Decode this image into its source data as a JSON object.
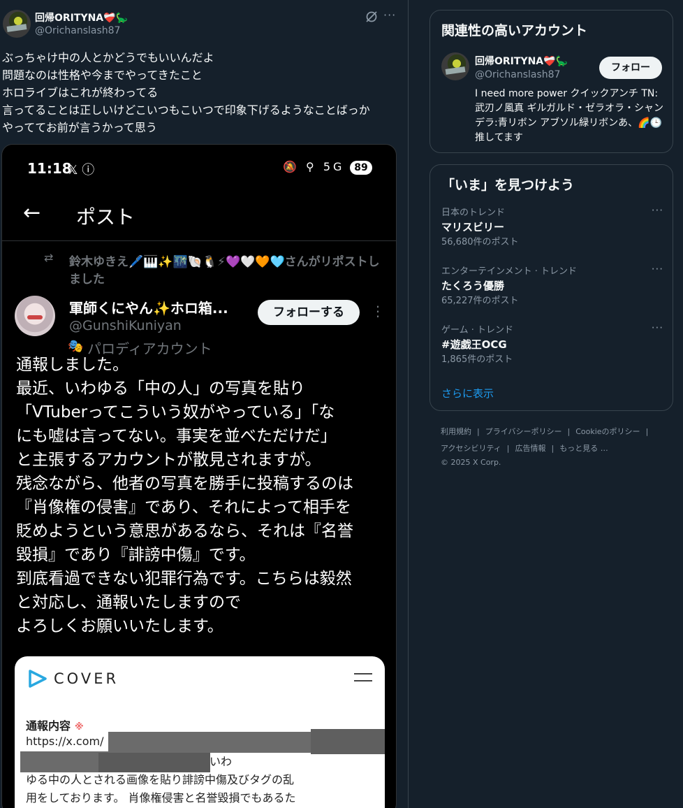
{
  "post": {
    "display_name": "回帰ORITYNA❤️‍🩹🦕",
    "handle": "@Orichanslash87",
    "text": "ぶっちゃけ中の人とかどうでもいいんだよ\n問題なのは性格や今までやってきたこと\nホロライブはこれが終わってる\n言ってることは正しいけどこいつもこいつで印象下げるようなことばっか\nやっててお前が言うかって思う",
    "icons": {
      "grok": "grok-icon",
      "more": "more-icon"
    }
  },
  "embedded": {
    "status_time": "11:18",
    "status_left_icons": "𝕏 ⓘ",
    "status_right_icons": "🔕 ⚲ 5G .ıl",
    "battery": "89",
    "screen_title": "ポスト",
    "repost_text": "鈴木ゆきえ🖊️🎹✨🌃🐚🐧⚡💜🤍🧡🩵さんがリポストしました",
    "author_name": "軍師くにやん✨ホロ箱...",
    "author_handle": "@GunshiKuniyan",
    "parody_label": "パロディアカウント",
    "follow_label": "フォローする",
    "body": "通報しました。\n最近、いわゆる「中の人」の写真を貼り\n「VTuberってこういう奴がやっている」「な\nにも嘘は言ってない。事実を並べただけだ」\nと主張するアカウントが散見されますが。\n残念ながら、他者の写真を勝手に投稿するのは\n『肖像権の侵害』であり、それによって相手を\n貶めようという意思があるなら、それは『名誉\n毀損』であり『誹謗中傷』です。\n到底看過できない犯罪行為です。こちらは毅然\nと対応し、通報いたしますので\nよろしくお願いいたします。",
    "card": {
      "brand": "COVER",
      "report_label": "通報内容",
      "required_mark": "※",
      "url": "https://x.com/",
      "body": "                              9 こちらにて、いわ\nゆる中の人とされる画像を貼り誹謗中傷及びタグの乱\n用をしております。 肖像権侵害と名誉毀損でもあるた"
    }
  },
  "sidebar": {
    "related": {
      "title": "関連性の高いアカウント",
      "name": "回帰ORITYNA❤️‍🩹🦕",
      "handle": "@Orichanslash87",
      "follow_label": "フォロー",
      "bio": "I need more power クイックアンチ TN: 武刃ノ風真 ギルガルド・ゼラオラ・シャンデラ:青リボン アブソル緑リボンあ、🌈🕒推してます"
    },
    "trends": {
      "title": "「いま」を見つけよう",
      "items": [
        {
          "category": "日本のトレンド",
          "name": "マリスビリー",
          "count": "56,680件のポスト"
        },
        {
          "category": "エンターテインメント · トレンド",
          "name": "たくろう優勝",
          "count": "65,227件のポスト"
        },
        {
          "category": "ゲーム · トレンド",
          "name": "#遊戯王OCG",
          "count": "1,865件のポスト"
        }
      ],
      "show_more": "さらに表示"
    },
    "footer": {
      "links": [
        "利用規約",
        "プライバシーポリシー",
        "Cookieのポリシー",
        "アクセシビリティ",
        "広告情報",
        "もっと見る …"
      ],
      "copyright": "© 2025 X Corp."
    }
  }
}
